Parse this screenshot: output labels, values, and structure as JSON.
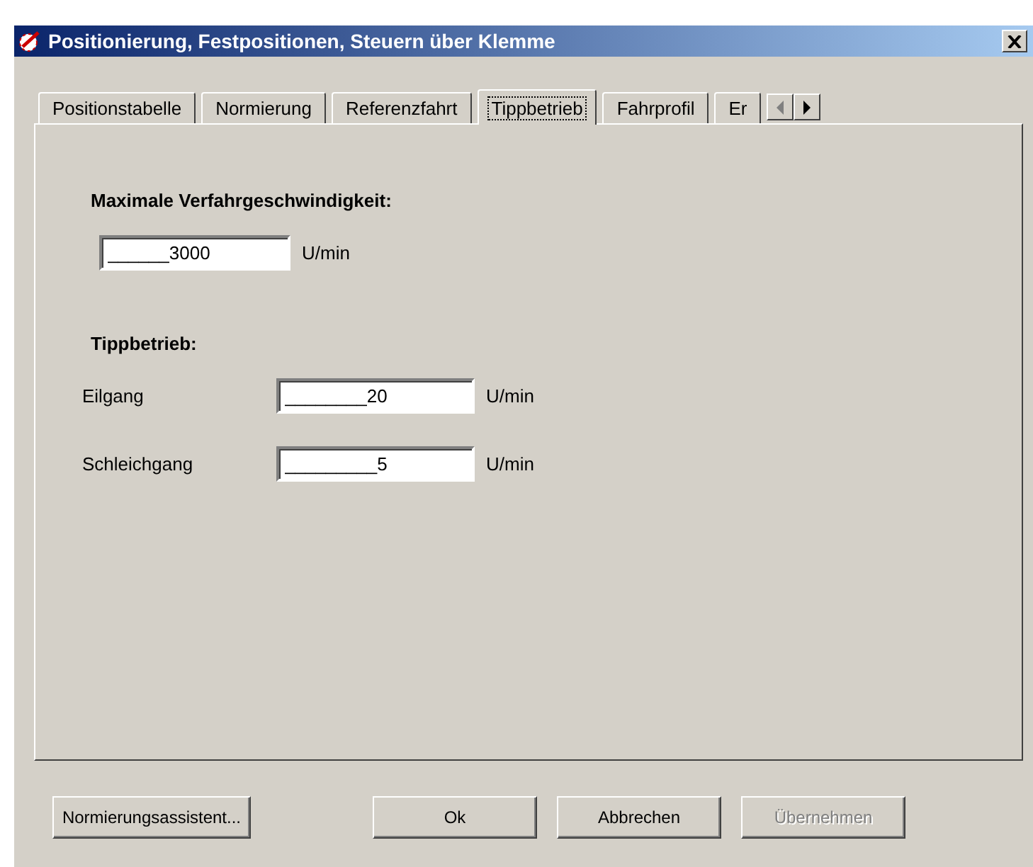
{
  "window": {
    "title": "Positionierung, Festpositionen, Steuern über Klemme"
  },
  "tabs": [
    {
      "label": "Positionstabelle",
      "selected": false
    },
    {
      "label": "Normierung",
      "selected": false
    },
    {
      "label": "Referenzfahrt",
      "selected": false
    },
    {
      "label": "Tippbetrieb",
      "selected": true
    },
    {
      "label": "Fahrprofil",
      "selected": false
    },
    {
      "label": "Er",
      "selected": false
    }
  ],
  "sections": [
    {
      "heading": "Maximale Verfahrgeschwindigkeit:",
      "fields": [
        {
          "value": "______3000",
          "unit": "U/min"
        }
      ]
    },
    {
      "heading": "Tippbetrieb:",
      "fields": [
        {
          "label": "Eilgang",
          "value": "________20",
          "unit": "U/min"
        },
        {
          "label": "Schleichgang",
          "value": "_________5",
          "unit": "U/min"
        }
      ]
    }
  ],
  "buttons": [
    {
      "label": "Normierungsassistent...",
      "disabled": false
    },
    {
      "label": "Ok",
      "disabled": false
    },
    {
      "label": "Abbrechen",
      "disabled": false
    },
    {
      "label": "Übernehmen",
      "disabled": true
    }
  ]
}
